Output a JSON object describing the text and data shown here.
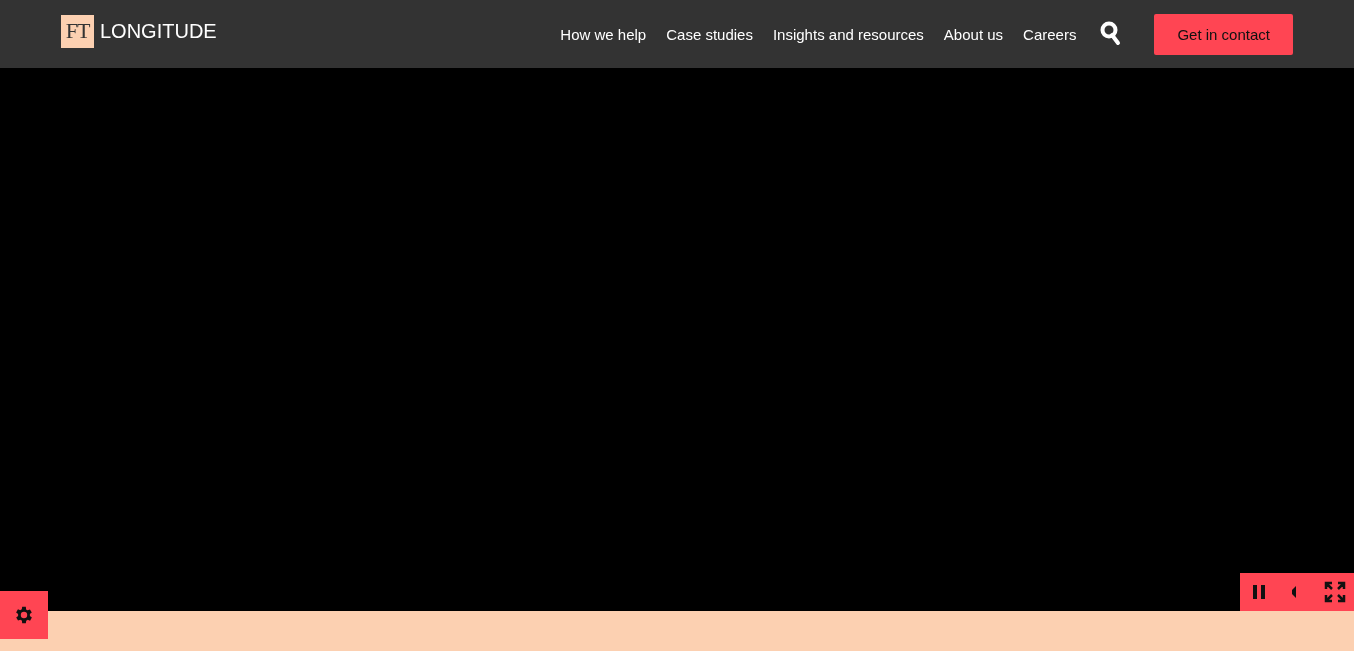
{
  "header": {
    "logo": {
      "mark": "FT",
      "name": "LONGITUDE"
    },
    "nav": [
      {
        "label": "How we help"
      },
      {
        "label": "Case studies"
      },
      {
        "label": "Insights and resources"
      },
      {
        "label": "About us"
      },
      {
        "label": "Careers"
      }
    ],
    "cta": "Get in contact"
  },
  "video": {
    "playing": true,
    "muted": false
  }
}
